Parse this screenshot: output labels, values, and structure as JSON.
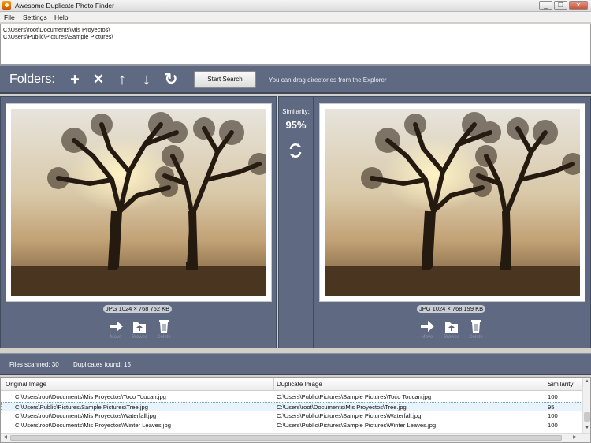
{
  "window": {
    "title": "Awesome Duplicate Photo Finder",
    "controls": {
      "minimize": "_",
      "maximize": "❐",
      "close": "✕"
    }
  },
  "menu": [
    "File",
    "Settings",
    "Help"
  ],
  "folders": [
    "C:\\Users\\root\\Documents\\Mis Proyectos\\",
    "C:\\Users\\Public\\Pictures\\Sample Pictures\\"
  ],
  "toolbar": {
    "label": "Folders:",
    "icons": {
      "add": "+",
      "remove": "✕",
      "up": "↑",
      "down": "↓",
      "reset": "↻"
    },
    "start_button": "Start Search",
    "hint": "You can drag directories from the Explorer"
  },
  "left_image": {
    "info": "JPG  1024 × 768  752 KB",
    "actions": [
      "Move",
      "Browse",
      "Delete"
    ]
  },
  "right_image": {
    "info": "JPG  1024 × 768  199 KB",
    "actions": [
      "Move",
      "Browse",
      "Delete"
    ]
  },
  "similarity": {
    "label": "Similarity:",
    "value": "95%"
  },
  "status": {
    "files_scanned": "Files scanned: 30",
    "duplicates_found": "Duplicates found: 15"
  },
  "results": {
    "columns": [
      "Original Image",
      "Duplicate Image",
      "Similarity"
    ],
    "rows": [
      [
        "C:\\Users\\root\\Documents\\Mis Proyectos\\Toco Toucan.jpg",
        "C:\\Users\\Public\\Pictures\\Sample Pictures\\Toco Toucan.jpg",
        "100"
      ],
      [
        "C:\\Users\\Public\\Pictures\\Sample Pictures\\Tree.jpg",
        "C:\\Users\\root\\Documents\\Mis Proyectos\\Tree.jpg",
        "95"
      ],
      [
        "C:\\Users\\root\\Documents\\Mis Proyectos\\Waterfall.jpg",
        "C:\\Users\\Public\\Pictures\\Sample Pictures\\Waterfall.jpg",
        "100"
      ],
      [
        "C:\\Users\\root\\Documents\\Mis Proyectos\\Winter Leaves.jpg",
        "C:\\Users\\Public\\Pictures\\Sample Pictures\\Winter Leaves.jpg",
        "100"
      ]
    ],
    "selected_row": 1
  },
  "colors": {
    "panel": "#5f6a82",
    "panel_border": "#434b5e",
    "selection": "#e8f3fb"
  }
}
